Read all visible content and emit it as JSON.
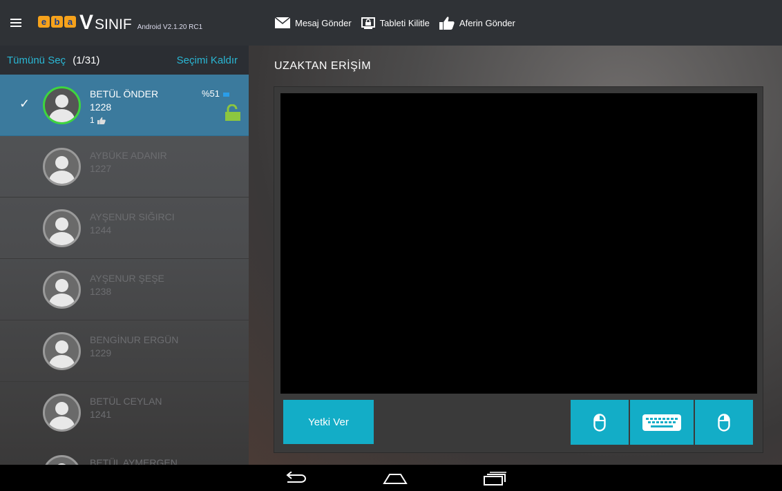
{
  "app": {
    "logo_text": "eba",
    "brand_v": "V",
    "brand_word": "SINIF",
    "version": "Android V2.1.20 RC1"
  },
  "toolbar": {
    "send_message": "Mesaj Gönder",
    "lock_tablet": "Tableti Kilitle",
    "send_praise": "Aferin Gönder"
  },
  "left_panel": {
    "select_all": "Tümünü Seç",
    "count": "(1/31)",
    "clear_selection": "Seçimi Kaldır"
  },
  "students": [
    {
      "name": "BETÜL ÖNDER",
      "number": "1228",
      "likes": "1",
      "battery": "%51",
      "selected": true,
      "unlocked": true
    },
    {
      "name": "AYBÜKE ADANIR",
      "number": "1227"
    },
    {
      "name": "AYŞENUR SIĞIRCI",
      "number": "1244"
    },
    {
      "name": "AYŞENUR ŞEŞE",
      "number": "1238"
    },
    {
      "name": "BENGİNUR ERGÜN",
      "number": "1229"
    },
    {
      "name": "BETÜL CEYLAN",
      "number": "1241"
    },
    {
      "name": "BETÜL AYMERGEN",
      "number": ""
    }
  ],
  "main": {
    "title": "UZAKTAN ERİŞİM",
    "grant_button": "Yetki Ver"
  },
  "colors": {
    "accent": "#13adc7",
    "selected_row": "#3b7a9d",
    "online_ring": "#3ed63e",
    "lock": "#8cc63f"
  },
  "icons": {
    "menu": "hamburger-icon",
    "message": "envelope-icon",
    "lock": "screen-lock-icon",
    "praise": "thumbs-up-icon",
    "mouse": "mouse-icon",
    "keyboard": "keyboard-icon",
    "back": "back-icon",
    "home": "home-icon",
    "recents": "recents-icon"
  }
}
